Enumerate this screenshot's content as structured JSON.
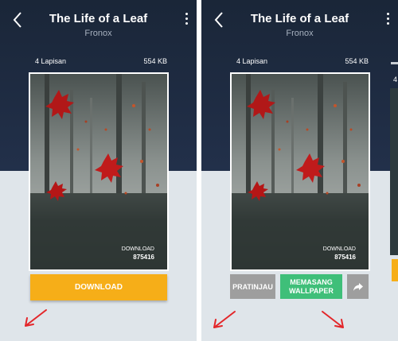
{
  "app": {
    "title": "The Life of a Leaf",
    "author": "Fronox",
    "layers": "4 Lapisan",
    "file_size": "554 KB",
    "download_label": "DOWNLOAD",
    "download_count": "875416"
  },
  "left_panel": {
    "download_button": "DOWNLOAD"
  },
  "right_panel": {
    "preview_button": "PRATINJAU",
    "install_button": "MEMASANG WALLPAPER",
    "side_peek_text": "4"
  },
  "icons": {
    "back": "chevron-left-icon",
    "more": "more-vert-icon",
    "share": "share-icon",
    "annotation": "red-arrow-icon"
  },
  "colors": {
    "header": "#1a2638",
    "download": "#f6ae18",
    "install": "#3fbf79",
    "preview": "#9e9e9e",
    "annotation": "#e3262a"
  }
}
